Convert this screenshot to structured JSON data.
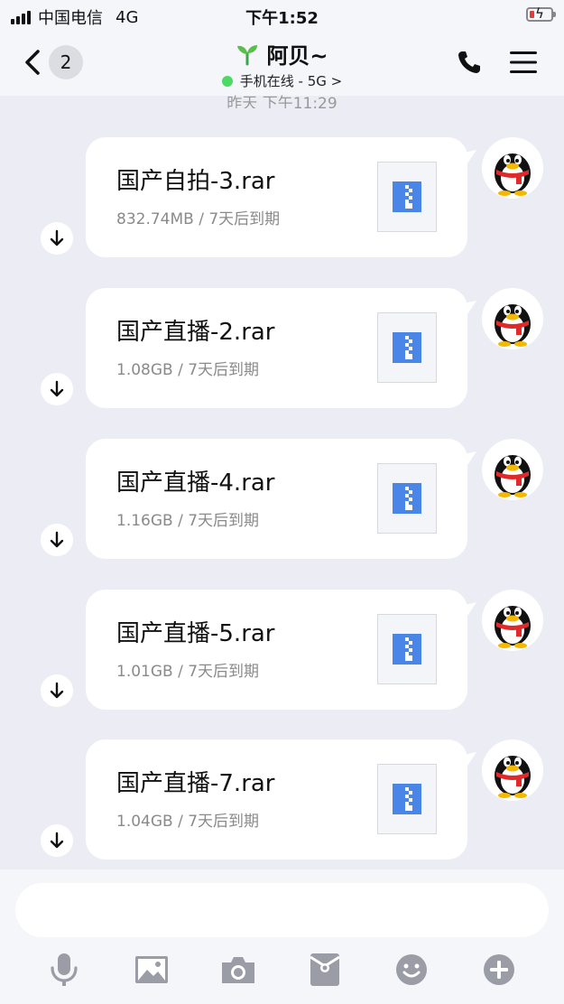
{
  "status_bar": {
    "carrier": "中国电信",
    "network": "4G",
    "time": "下午1:52",
    "battery_color": "#e23b3b"
  },
  "nav": {
    "back_icon": "chevron-left-icon",
    "unread_count": "2",
    "contact_name": "阿贝~",
    "contact_icon": "sprout-icon",
    "status_text": "手机在线 - 5G >",
    "status_color": "#4cd964",
    "right_icons": [
      "phone-icon",
      "menu-icon"
    ]
  },
  "chat": {
    "timestamp": "昨天 下午11:29",
    "messages": [
      {
        "file_name": "国产自拍-3.rar",
        "file_meta": "832.74MB / 7天后到期"
      },
      {
        "file_name": "国产直播-2.rar",
        "file_meta": "1.08GB / 7天后到期"
      },
      {
        "file_name": "国产直播-4.rar",
        "file_meta": "1.16GB / 7天后到期"
      },
      {
        "file_name": "国产直播-5.rar",
        "file_meta": "1.01GB / 7天后到期"
      },
      {
        "file_name": "国产直播-7.rar",
        "file_meta": "1.04GB / 7天后到期"
      }
    ],
    "file_icon": "zip-archive-icon",
    "download_icon": "download-arrow-icon",
    "avatar": "penguin-avatar-icon",
    "accent_color": "#4a86e8"
  },
  "toolbar": {
    "icons": [
      "microphone-icon",
      "image-icon",
      "camera-icon",
      "red-packet-icon",
      "emoji-icon",
      "plus-icon"
    ]
  }
}
